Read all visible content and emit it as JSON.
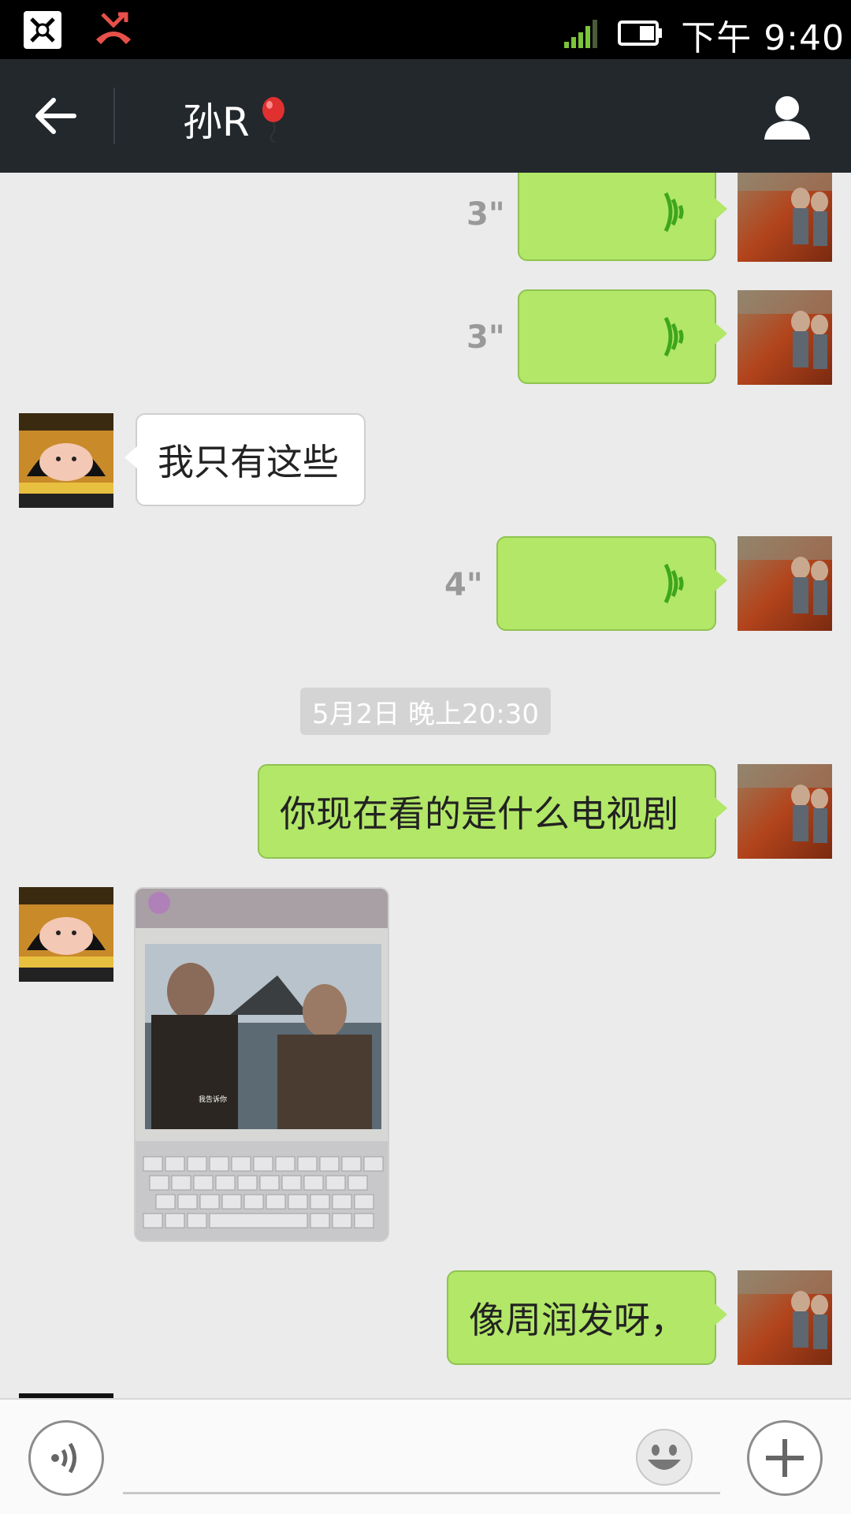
{
  "status_bar": {
    "time": "下午 9:40",
    "icons": [
      "app-notification-icon",
      "missed-call-icon",
      "signal-icon",
      "battery-icon"
    ]
  },
  "header": {
    "title": "孙R",
    "title_icon": "balloon-icon",
    "back_icon": "back-arrow-icon",
    "profile_icon": "profile-icon"
  },
  "messages": [
    {
      "type": "voice",
      "direction": "out",
      "duration": "3\""
    },
    {
      "type": "voice",
      "direction": "out",
      "duration": "3\""
    },
    {
      "type": "text",
      "direction": "in",
      "text": "我只有这些"
    },
    {
      "type": "voice",
      "direction": "out",
      "duration": "4\""
    },
    {
      "type": "timestamp",
      "text": "5月2日 晚上20:30"
    },
    {
      "type": "text",
      "direction": "out",
      "text": "你现在看的是什么电视剧"
    },
    {
      "type": "image",
      "direction": "in",
      "subtitle": "我告诉你"
    },
    {
      "type": "text",
      "direction": "out",
      "text": "像周润发呀，"
    }
  ],
  "input_bar": {
    "placeholder": "",
    "voice_icon": "voice-input-icon",
    "emoji_icon": "emoji-icon",
    "plus_icon": "plus-icon"
  },
  "colors": {
    "outgoing_bubble": "#b2e768",
    "incoming_bubble": "#ffffff",
    "chat_background": "#ebebeb",
    "header_background": "#23282d",
    "voice_wave": "#3ea61c"
  }
}
